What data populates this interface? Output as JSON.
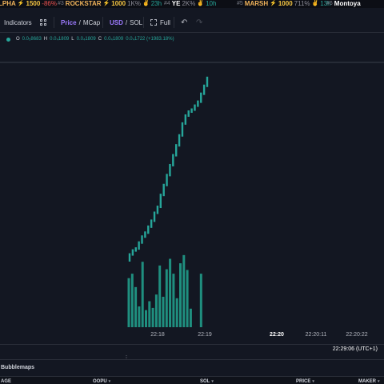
{
  "ticker": [
    {
      "rank": "",
      "name": "LPHA",
      "name_color": "#f0b35a",
      "bolt_value": "1500",
      "change": "-86%",
      "change_kind": "neg",
      "extra": ""
    },
    {
      "rank": "#3",
      "name": "ROCKSTAR",
      "name_color": "#f0b35a",
      "bolt_value": "1000",
      "change": "1K%",
      "change_kind": "pos",
      "extra": "23h"
    },
    {
      "rank": "#4",
      "name": "YE",
      "name_color": "#ffffff",
      "bolt_value": "",
      "change": "2K%",
      "change_kind": "pos",
      "extra": "10h"
    },
    {
      "rank": "#5",
      "name": "MARSH",
      "name_color": "#f0b35a",
      "bolt_value": "1000",
      "change": "711%",
      "change_kind": "pos",
      "extra": "13h"
    },
    {
      "rank": "#6",
      "name": "Montoya",
      "name_color": "#ffffff",
      "bolt_value": "",
      "change": "",
      "change_kind": "pos",
      "extra": ""
    }
  ],
  "toolbar": {
    "indicators_label": "Indicators",
    "price_label": "Price",
    "mcap_label": "MCap",
    "slash": "/",
    "usd_label": "USD",
    "sol_label": "SOL",
    "full_label": "Full",
    "undo_glyph": "↶",
    "redo_glyph": "↷"
  },
  "ohlc": {
    "o_key": "O",
    "o_val": "0.0₅8683",
    "h_key": "H",
    "h_val": "0.0₄1809",
    "l_key": "L",
    "l_val": "0.0₄1809",
    "c_key": "C",
    "c_val": "0.0₄1809",
    "c_change": "0.0₄1722 (+1983.18%)"
  },
  "colors": {
    "up": "#26a69a",
    "volume": "#1f8f7f",
    "background": "#131722",
    "accent": "#9d7bff"
  },
  "chart_data": {
    "type": "candlestick",
    "candles_close_relative": [
      0.03,
      0.05,
      0.06,
      0.09,
      0.12,
      0.14,
      0.17,
      0.2,
      0.24,
      0.27,
      0.33,
      0.38,
      0.43,
      0.48,
      0.53,
      0.58,
      0.63,
      0.69,
      0.73,
      0.75,
      0.76,
      0.78,
      0.8,
      0.84,
      0.88,
      0.92
    ],
    "volume_relative": [
      0.67,
      0.73,
      0.55,
      0.29,
      0.89,
      0.24,
      0.36,
      0.27,
      0.45,
      0.84,
      0.42,
      0.79,
      0.93,
      0.73,
      0.4,
      0.87,
      0.98,
      0.78,
      0.26,
      0.0,
      0.0,
      0.73
    ]
  },
  "time_axis": {
    "labels": [
      "22:18",
      "22:19",
      "22:20",
      "22:20:11",
      "22:20:22"
    ],
    "bold_labels": [
      "22:20"
    ]
  },
  "clock": "22:29:06 (UTC+1)",
  "drag_handle_glyph": "⋮",
  "bubblemaps_label": "Bubblemaps",
  "table_headers": [
    "AGE",
    "OOPU",
    "SOL",
    "PRICE",
    "MAKER"
  ]
}
